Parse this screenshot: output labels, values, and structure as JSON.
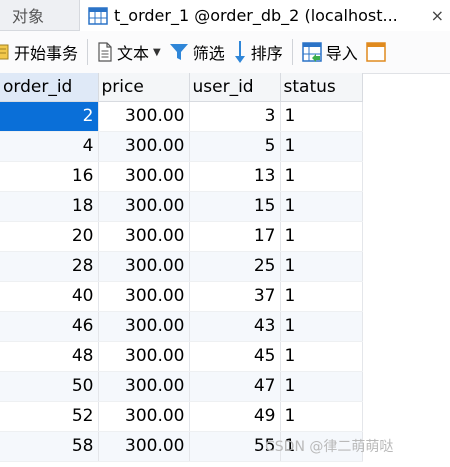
{
  "tabs": {
    "objects_label": "对象",
    "active_label": "t_order_1 @order_db_2 (localhost...",
    "close_symbol": "×"
  },
  "toolbar": {
    "begin_transaction": "开始事务",
    "text": "文本",
    "filter": "筛选",
    "sort": "排序",
    "import": "导入"
  },
  "grid": {
    "columns": [
      "order_id",
      "price",
      "user_id",
      "status"
    ],
    "rows": [
      [
        "2",
        "300.00",
        "3",
        "1"
      ],
      [
        "4",
        "300.00",
        "5",
        "1"
      ],
      [
        "16",
        "300.00",
        "13",
        "1"
      ],
      [
        "18",
        "300.00",
        "15",
        "1"
      ],
      [
        "20",
        "300.00",
        "17",
        "1"
      ],
      [
        "28",
        "300.00",
        "25",
        "1"
      ],
      [
        "40",
        "300.00",
        "37",
        "1"
      ],
      [
        "46",
        "300.00",
        "43",
        "1"
      ],
      [
        "48",
        "300.00",
        "45",
        "1"
      ],
      [
        "50",
        "300.00",
        "47",
        "1"
      ],
      [
        "52",
        "300.00",
        "49",
        "1"
      ],
      [
        "58",
        "300.00",
        "55",
        "1"
      ]
    ]
  },
  "watermark": "CSDN @律二萌萌哒"
}
